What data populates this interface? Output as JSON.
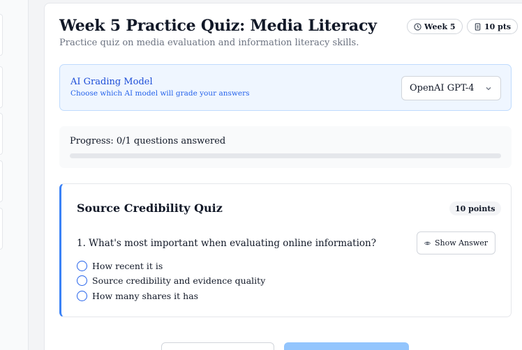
{
  "quiz": {
    "title": "Week 5 Practice Quiz: Media Literacy",
    "subtitle": "Practice quiz on media evaluation and information literacy skills.",
    "badges": {
      "week": "Week 5",
      "points": "10 pts"
    }
  },
  "grading": {
    "title": "AI Grading Model",
    "description": "Choose which AI model will grade your answers",
    "selected_model": "OpenAI GPT-4"
  },
  "progress": {
    "label": "Progress: 0/1 questions answered",
    "fraction": 0
  },
  "section": {
    "title": "Source Credibility Quiz",
    "points": "10 points",
    "question": "1. What's most important when evaluating online information?",
    "show_answer_label": "Show Answer",
    "options": [
      "How recent it is",
      "Source credibility and evidence quality",
      "How many shares it has"
    ]
  },
  "colors": {
    "accent": "#3b82f6",
    "info_bg": "#eff6ff",
    "info_text": "#1d4ed8"
  }
}
